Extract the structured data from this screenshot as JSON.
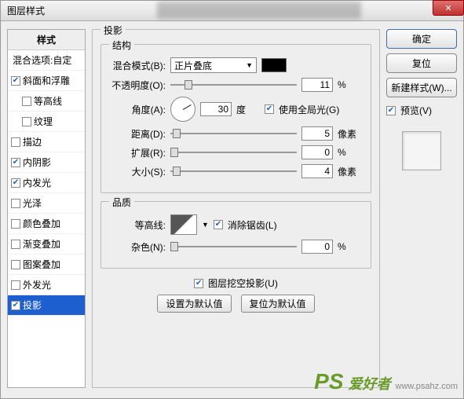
{
  "window": {
    "title": "图层样式"
  },
  "sidebar": {
    "head": "样式",
    "blend": "混合选项:自定",
    "items": [
      {
        "label": "斜面和浮雕",
        "checked": true,
        "indent": false,
        "selected": false
      },
      {
        "label": "等高线",
        "checked": false,
        "indent": true,
        "selected": false
      },
      {
        "label": "纹理",
        "checked": false,
        "indent": true,
        "selected": false
      },
      {
        "label": "描边",
        "checked": false,
        "indent": false,
        "selected": false
      },
      {
        "label": "内阴影",
        "checked": true,
        "indent": false,
        "selected": false
      },
      {
        "label": "内发光",
        "checked": true,
        "indent": false,
        "selected": false
      },
      {
        "label": "光泽",
        "checked": false,
        "indent": false,
        "selected": false
      },
      {
        "label": "颜色叠加",
        "checked": false,
        "indent": false,
        "selected": false
      },
      {
        "label": "渐变叠加",
        "checked": false,
        "indent": false,
        "selected": false
      },
      {
        "label": "图案叠加",
        "checked": false,
        "indent": false,
        "selected": false
      },
      {
        "label": "外发光",
        "checked": false,
        "indent": false,
        "selected": false
      },
      {
        "label": "投影",
        "checked": true,
        "indent": false,
        "selected": true
      }
    ]
  },
  "panel": {
    "title": "投影",
    "structure": {
      "title": "结构",
      "blendMode_label": "混合模式(B):",
      "blendMode_value": "正片叠底",
      "opacity_label": "不透明度(O):",
      "opacity_value": "11",
      "opacity_unit": "%",
      "angle_label": "角度(A):",
      "angle_value": "30",
      "angle_unit": "度",
      "global_label": "使用全局光(G)",
      "distance_label": "距离(D):",
      "distance_value": "5",
      "distance_unit": "像素",
      "spread_label": "扩展(R):",
      "spread_value": "0",
      "spread_unit": "%",
      "size_label": "大小(S):",
      "size_value": "4",
      "size_unit": "像素"
    },
    "quality": {
      "title": "品质",
      "contour_label": "等高线:",
      "antialias_label": "消除锯齿(L)",
      "noise_label": "杂色(N):",
      "noise_value": "0",
      "noise_unit": "%"
    },
    "knockout_label": "图层挖空投影(U)",
    "btn_default": "设置为默认值",
    "btn_reset": "复位为默认值"
  },
  "right": {
    "ok": "确定",
    "cancel": "复位",
    "newstyle": "新建样式(W)...",
    "preview_label": "预览(V)"
  },
  "watermark": {
    "ps": "PS",
    "text": "爱好者",
    "url": "www.psahz.com"
  }
}
